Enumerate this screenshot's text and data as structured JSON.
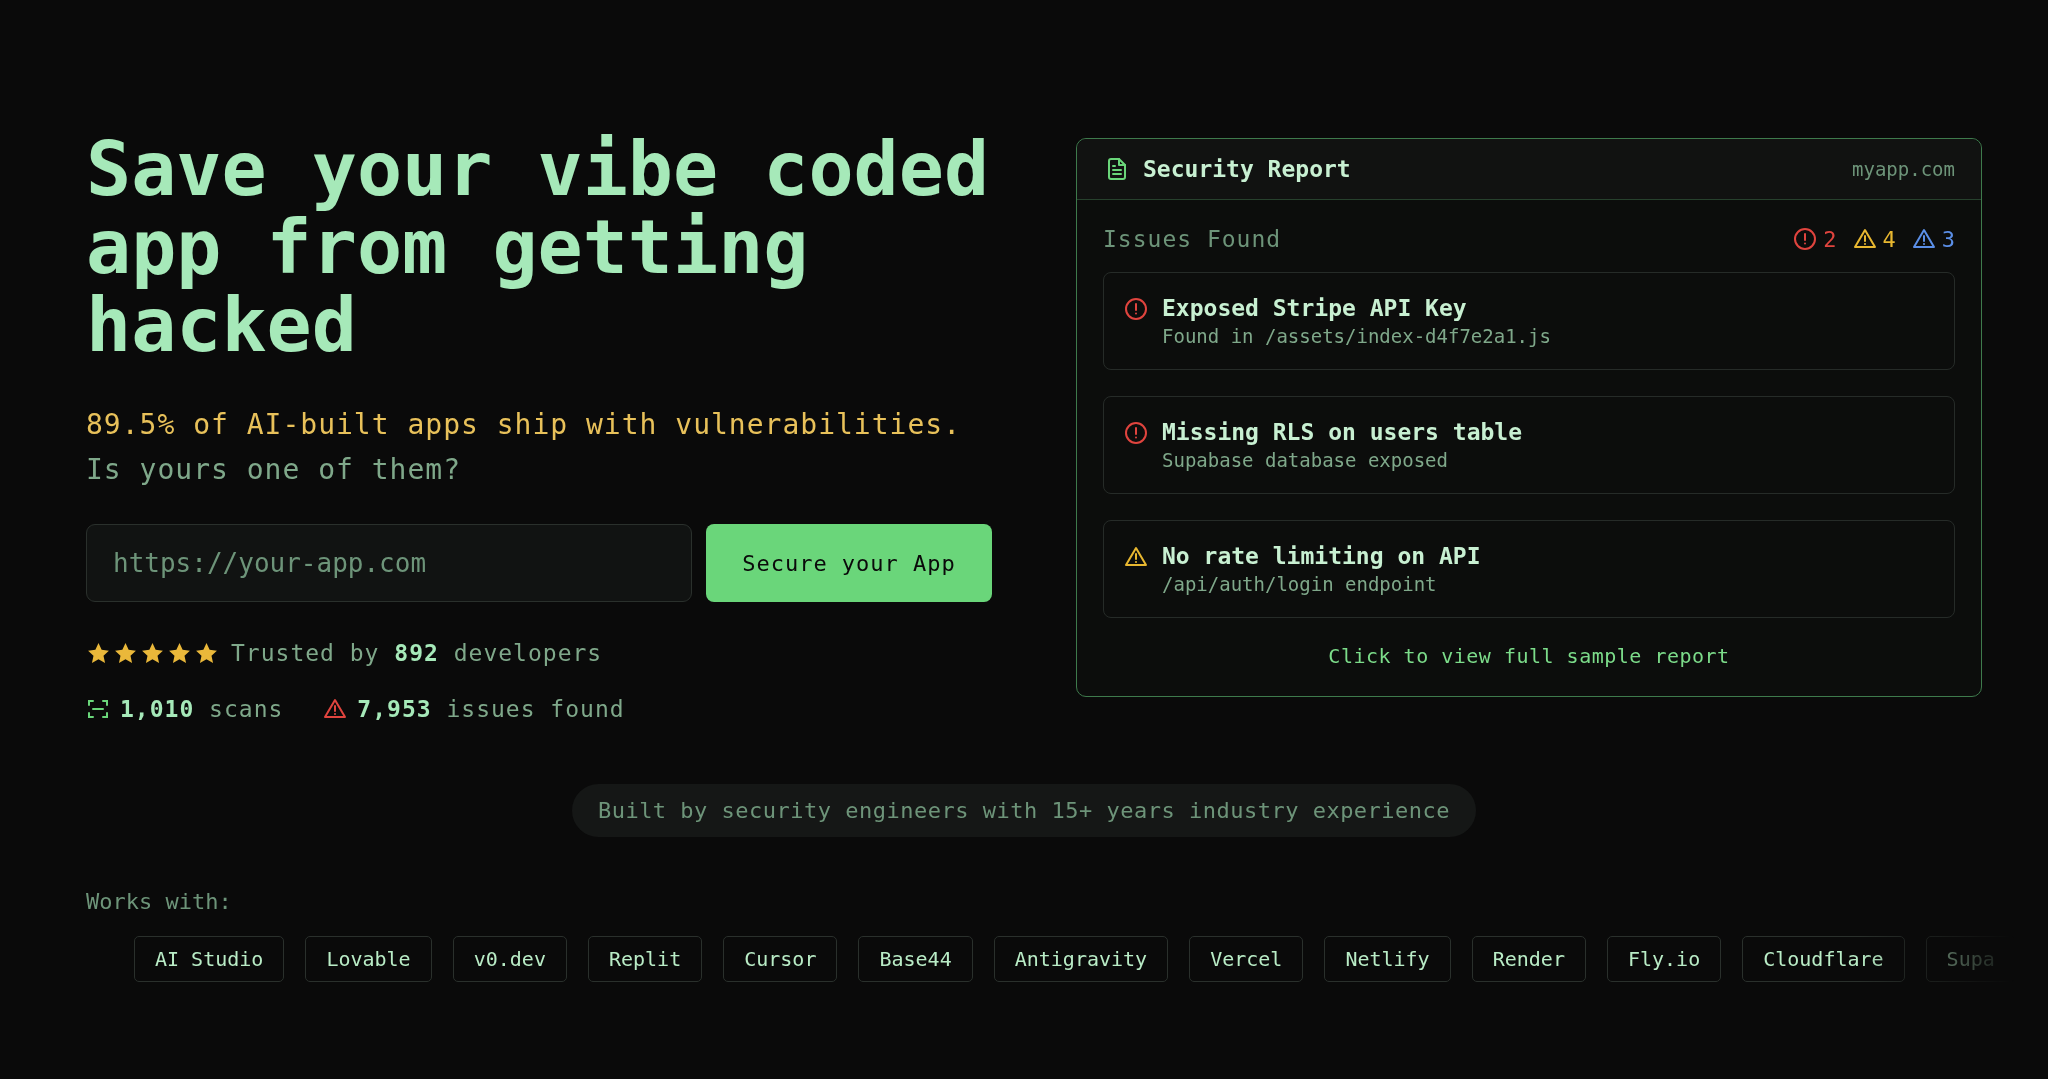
{
  "hero": {
    "headline": "Save your vibe coded app from getting hacked",
    "stat_line": "89.5% of AI-built apps ship with vulnerabilities.",
    "question": "Is yours one of them?"
  },
  "scan_form": {
    "placeholder": "https://your-app.com",
    "button": "Secure your App"
  },
  "rating": {
    "stars": 5,
    "prefix": "Trusted by",
    "count": "892",
    "suffix": "developers"
  },
  "stats": [
    {
      "kind": "scans",
      "value": "1,010",
      "label": "scans"
    },
    {
      "kind": "issues",
      "value": "7,953",
      "label": "issues found"
    }
  ],
  "report": {
    "title": "Security Report",
    "domain": "myapp.com",
    "issues_label": "Issues Found",
    "counts": [
      {
        "kind": "critical",
        "value": "2",
        "color": "#e0443e"
      },
      {
        "kind": "warning",
        "value": "4",
        "color": "#e8b730"
      },
      {
        "kind": "info",
        "value": "3",
        "color": "#5b8fe8"
      }
    ],
    "issues": [
      {
        "kind": "critical",
        "title": "Exposed Stripe API Key",
        "detail": "Found in /assets/index-d4f7e2a1.js"
      },
      {
        "kind": "critical",
        "title": "Missing RLS on users table",
        "detail": "Supabase database exposed"
      },
      {
        "kind": "warning",
        "title": "No rate limiting on API",
        "detail": "/api/auth/login endpoint"
      }
    ],
    "link": "Click to view full sample report"
  },
  "credentials": "Built by security engineers with 15+ years industry experience",
  "works_with": {
    "label": "Works with:",
    "platforms": [
      "AI Studio",
      "Lovable",
      "v0.dev",
      "Replit",
      "Cursor",
      "Base44",
      "Antigravity",
      "Vercel",
      "Netlify",
      "Render",
      "Fly.io",
      "Cloudflare",
      "Supa"
    ]
  }
}
